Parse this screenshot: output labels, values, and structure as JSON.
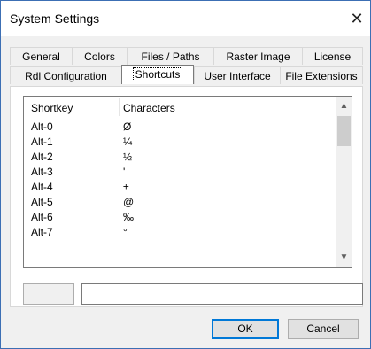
{
  "window": {
    "title": "System Settings",
    "close_glyph": "✕"
  },
  "tabs_row1": [
    "General",
    "Colors",
    "Files / Paths",
    "Raster Image",
    "License"
  ],
  "tabs_row2": [
    "Rdl Configuration",
    "Shortcuts",
    "User Interface",
    "File Extensions"
  ],
  "selected_tab": "Shortcuts",
  "list": {
    "headers": {
      "shortkey": "Shortkey",
      "characters": "Characters"
    },
    "rows": [
      {
        "key": "Alt-0",
        "char": "Ø"
      },
      {
        "key": "Alt-1",
        "char": "¼"
      },
      {
        "key": "Alt-2",
        "char": "½"
      },
      {
        "key": "Alt-3",
        "char": "'"
      },
      {
        "key": "Alt-4",
        "char": "±"
      },
      {
        "key": "Alt-5",
        "char": "@"
      },
      {
        "key": "Alt-6",
        "char": "‰"
      },
      {
        "key": "Alt-7",
        "char": "°"
      }
    ]
  },
  "editor": {
    "key_value": "",
    "char_value": ""
  },
  "buttons": {
    "ok": "OK",
    "cancel": "Cancel"
  },
  "colors": {
    "focus_border": "#0078d7",
    "window_border": "#3c6fb4"
  }
}
